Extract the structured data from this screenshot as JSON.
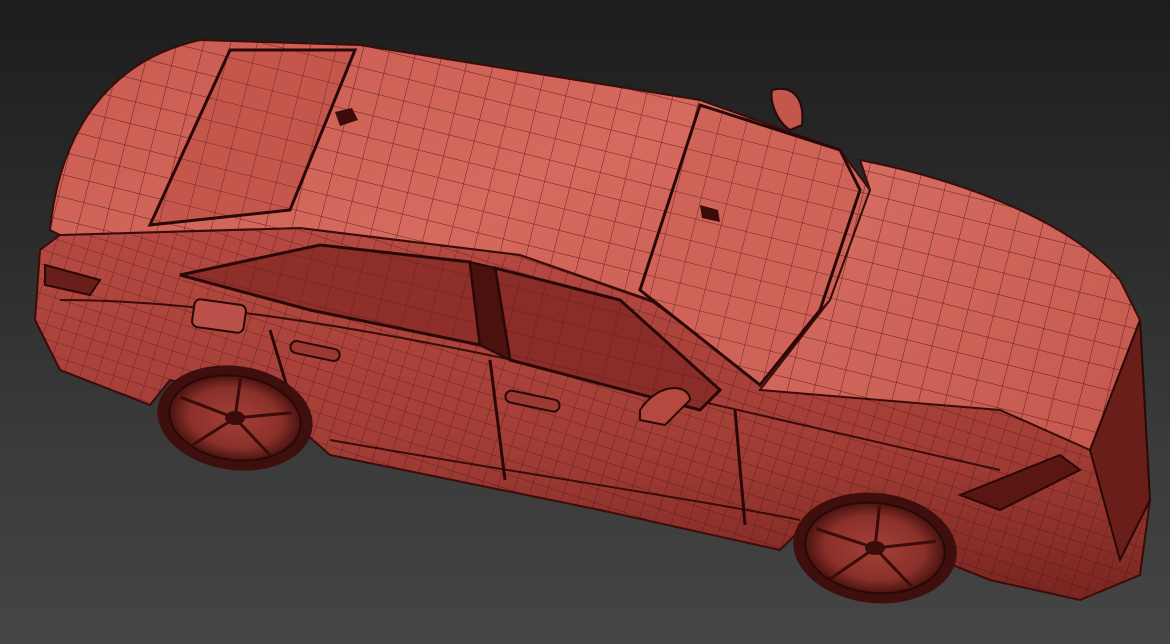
{
  "scene": {
    "subject": "car-wireframe-model",
    "view": "perspective-top",
    "shading": "smooth-with-wireframe-overlay"
  },
  "colors": {
    "background_top": "#1d1d1d",
    "background_bottom": "#454545",
    "body_light": "#d86a5e",
    "body_mid": "#b84c44",
    "body_dark": "#5a1612",
    "wire": "#3a0c0a",
    "glass": "#8e2f2a",
    "tire": "#3e0f0d"
  }
}
